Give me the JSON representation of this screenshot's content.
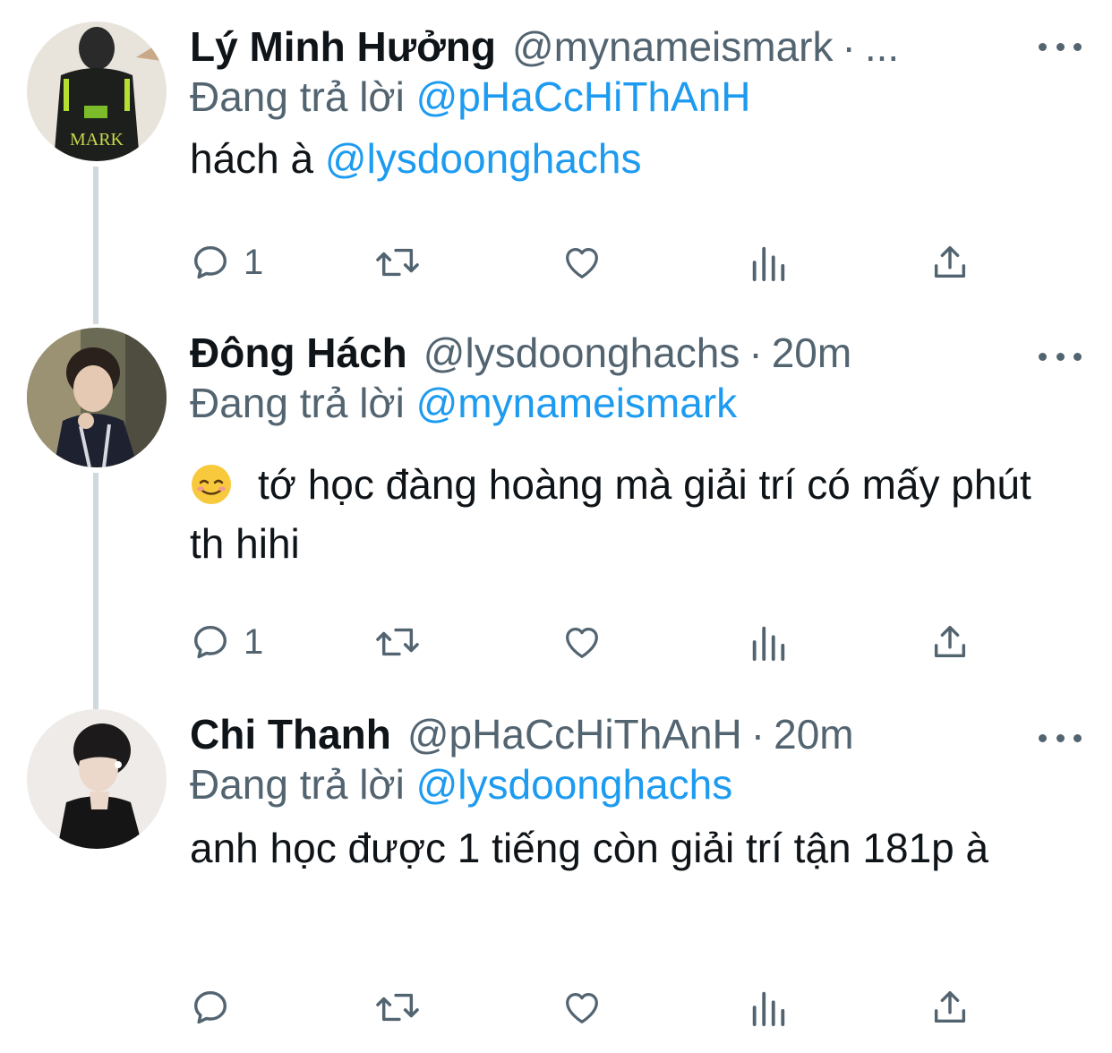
{
  "thread": [
    {
      "name": "Lý Minh Hưởng",
      "handle": "@mynameismark",
      "dot": "·",
      "time": "...",
      "reply_prefix": "Đang trả lời",
      "reply_to": "@pHaCcHiThAnH",
      "text_before_mention": "hách à ",
      "text_mention": "@lysdoonghachs",
      "reply_count": "1",
      "avatar_jersey_text": "MARK"
    },
    {
      "name": "Đông Hách",
      "handle": "@lysdoonghachs",
      "dot": "·",
      "time": "20m",
      "reply_prefix": "Đang trả lời",
      "reply_to": "@mynameismark",
      "emoji": "smiling-face-emoji",
      "text": "tớ học đàng hoàng mà giải trí có mấy phút th hihi",
      "reply_count": "1"
    },
    {
      "name": "Chi Thanh",
      "handle": "@pHaCcHiThAnH",
      "dot": "·",
      "time": "20m",
      "reply_prefix": "Đang trả lời",
      "reply_to": "@lysdoonghachs",
      "text": "anh học được 1 tiếng còn giải trí tận 181p à",
      "reply_count": ""
    }
  ],
  "icons": {
    "reply": "reply-icon",
    "retweet": "retweet-icon",
    "like": "heart-icon",
    "views": "analytics-icon",
    "share": "share-icon",
    "more": "more-icon"
  },
  "colors": {
    "text": "#0f1419",
    "secondary": "#536471",
    "accent": "#1d9bf0",
    "thread_line": "#cfd9de"
  }
}
